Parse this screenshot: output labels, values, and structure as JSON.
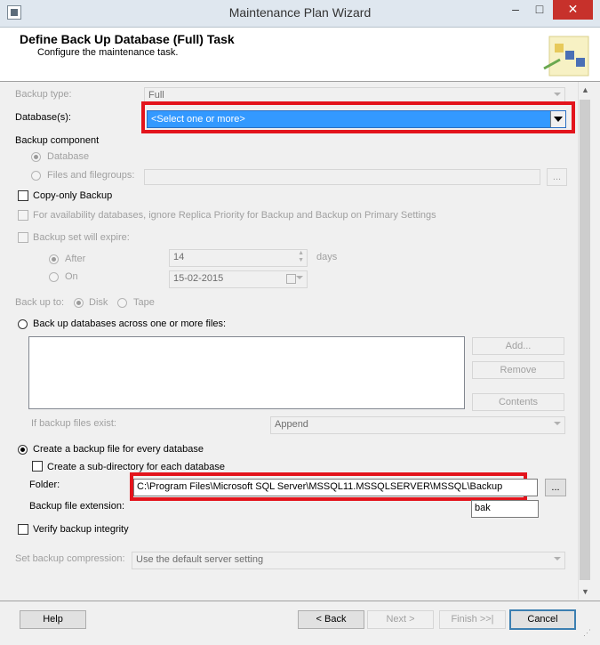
{
  "window": {
    "title": "Maintenance Plan Wizard",
    "minimize": "–",
    "maximize": "□",
    "close": "✕"
  },
  "header": {
    "title": "Define Back Up Database (Full) Task",
    "subtitle": "Configure the maintenance task."
  },
  "form": {
    "backup_type_label": "Backup type:",
    "backup_type_value": "Full",
    "databases_label": "Database(s):",
    "databases_value": "<Select one or more>",
    "backup_component_label": "Backup component",
    "component_database": "Database",
    "component_files": "Files and filegroups:",
    "ellipsis": "...",
    "copy_only": "Copy-only Backup",
    "availability": "For availability databases, ignore Replica Priority for Backup and Backup on Primary Settings",
    "expire_label": "Backup set will expire:",
    "after_label": "After",
    "after_value": "14",
    "days_label": "days",
    "on_label": "On",
    "on_value": "15-02-2015",
    "backup_to_label": "Back up to:",
    "disk_label": "Disk",
    "tape_label": "Tape",
    "across_files": "Back up databases across one or more files:",
    "add_button": "Add...",
    "remove_button": "Remove",
    "contents_button": "Contents",
    "if_exists_label": "If backup files exist:",
    "if_exists_value": "Append",
    "create_file": "Create a backup file for every database",
    "subdir": "Create a sub-directory for each database",
    "folder_label": "Folder:",
    "folder_value": "C:\\Program Files\\Microsoft SQL Server\\MSSQL11.MSSQLSERVER\\MSSQL\\Backup",
    "extension_label": "Backup file extension:",
    "extension_value": "bak",
    "verify": "Verify backup integrity",
    "compression_label": "Set backup compression:",
    "compression_value": "Use the default server setting"
  },
  "footer": {
    "help": "Help",
    "back": "< Back",
    "next": "Next >",
    "finish": "Finish >>|",
    "cancel": "Cancel"
  },
  "colors": {
    "highlight_red": "#e3141c",
    "selection_blue": "#3399ff",
    "close_red": "#c7312b"
  }
}
